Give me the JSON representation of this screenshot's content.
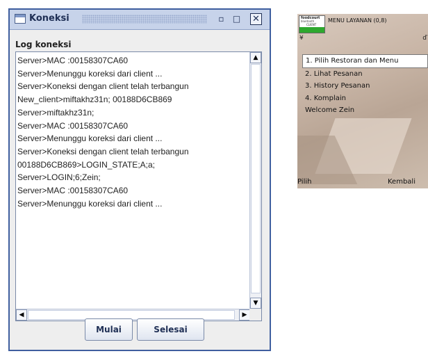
{
  "window": {
    "title": "Koneksi",
    "log_label": "Log koneksi",
    "log_lines": [
      "Server>MAC :00158307CA60",
      "Server>Menunggu koreksi dari client ...",
      "Server>Koneksi dengan client telah terbangun",
      "New_client>miftakhz31n; 00188D6CB869",
      "Server>miftakhz31n;",
      "Server>MAC :00158307CA60",
      "Server>Menunggu koreksi dari client ...",
      "Server>Koneksi dengan client telah terbangun",
      "00188D6CB869>LOGIN_STATE;A;a;",
      "Server>LOGIN;6;Zein;",
      "Server>MAC :00158307CA60",
      "Server>Menunggu koreksi dari client ..."
    ],
    "buttons": {
      "start": "Mulai",
      "finish": "Selesai"
    }
  },
  "phone": {
    "logo": {
      "line1": "foodcourt",
      "line2": "bluetooth",
      "line3": "CLIENT"
    },
    "menu_title": "MENU LAYANAN (0,8)",
    "menu_items": [
      "1. Pilih Restoran dan Menu",
      "2. Lihat Pesanan",
      "3. History Pesanan",
      "4. Komplain"
    ],
    "welcome": "Welcome Zein",
    "softkeys": {
      "left": "Pilih",
      "right": "Kembali"
    }
  }
}
